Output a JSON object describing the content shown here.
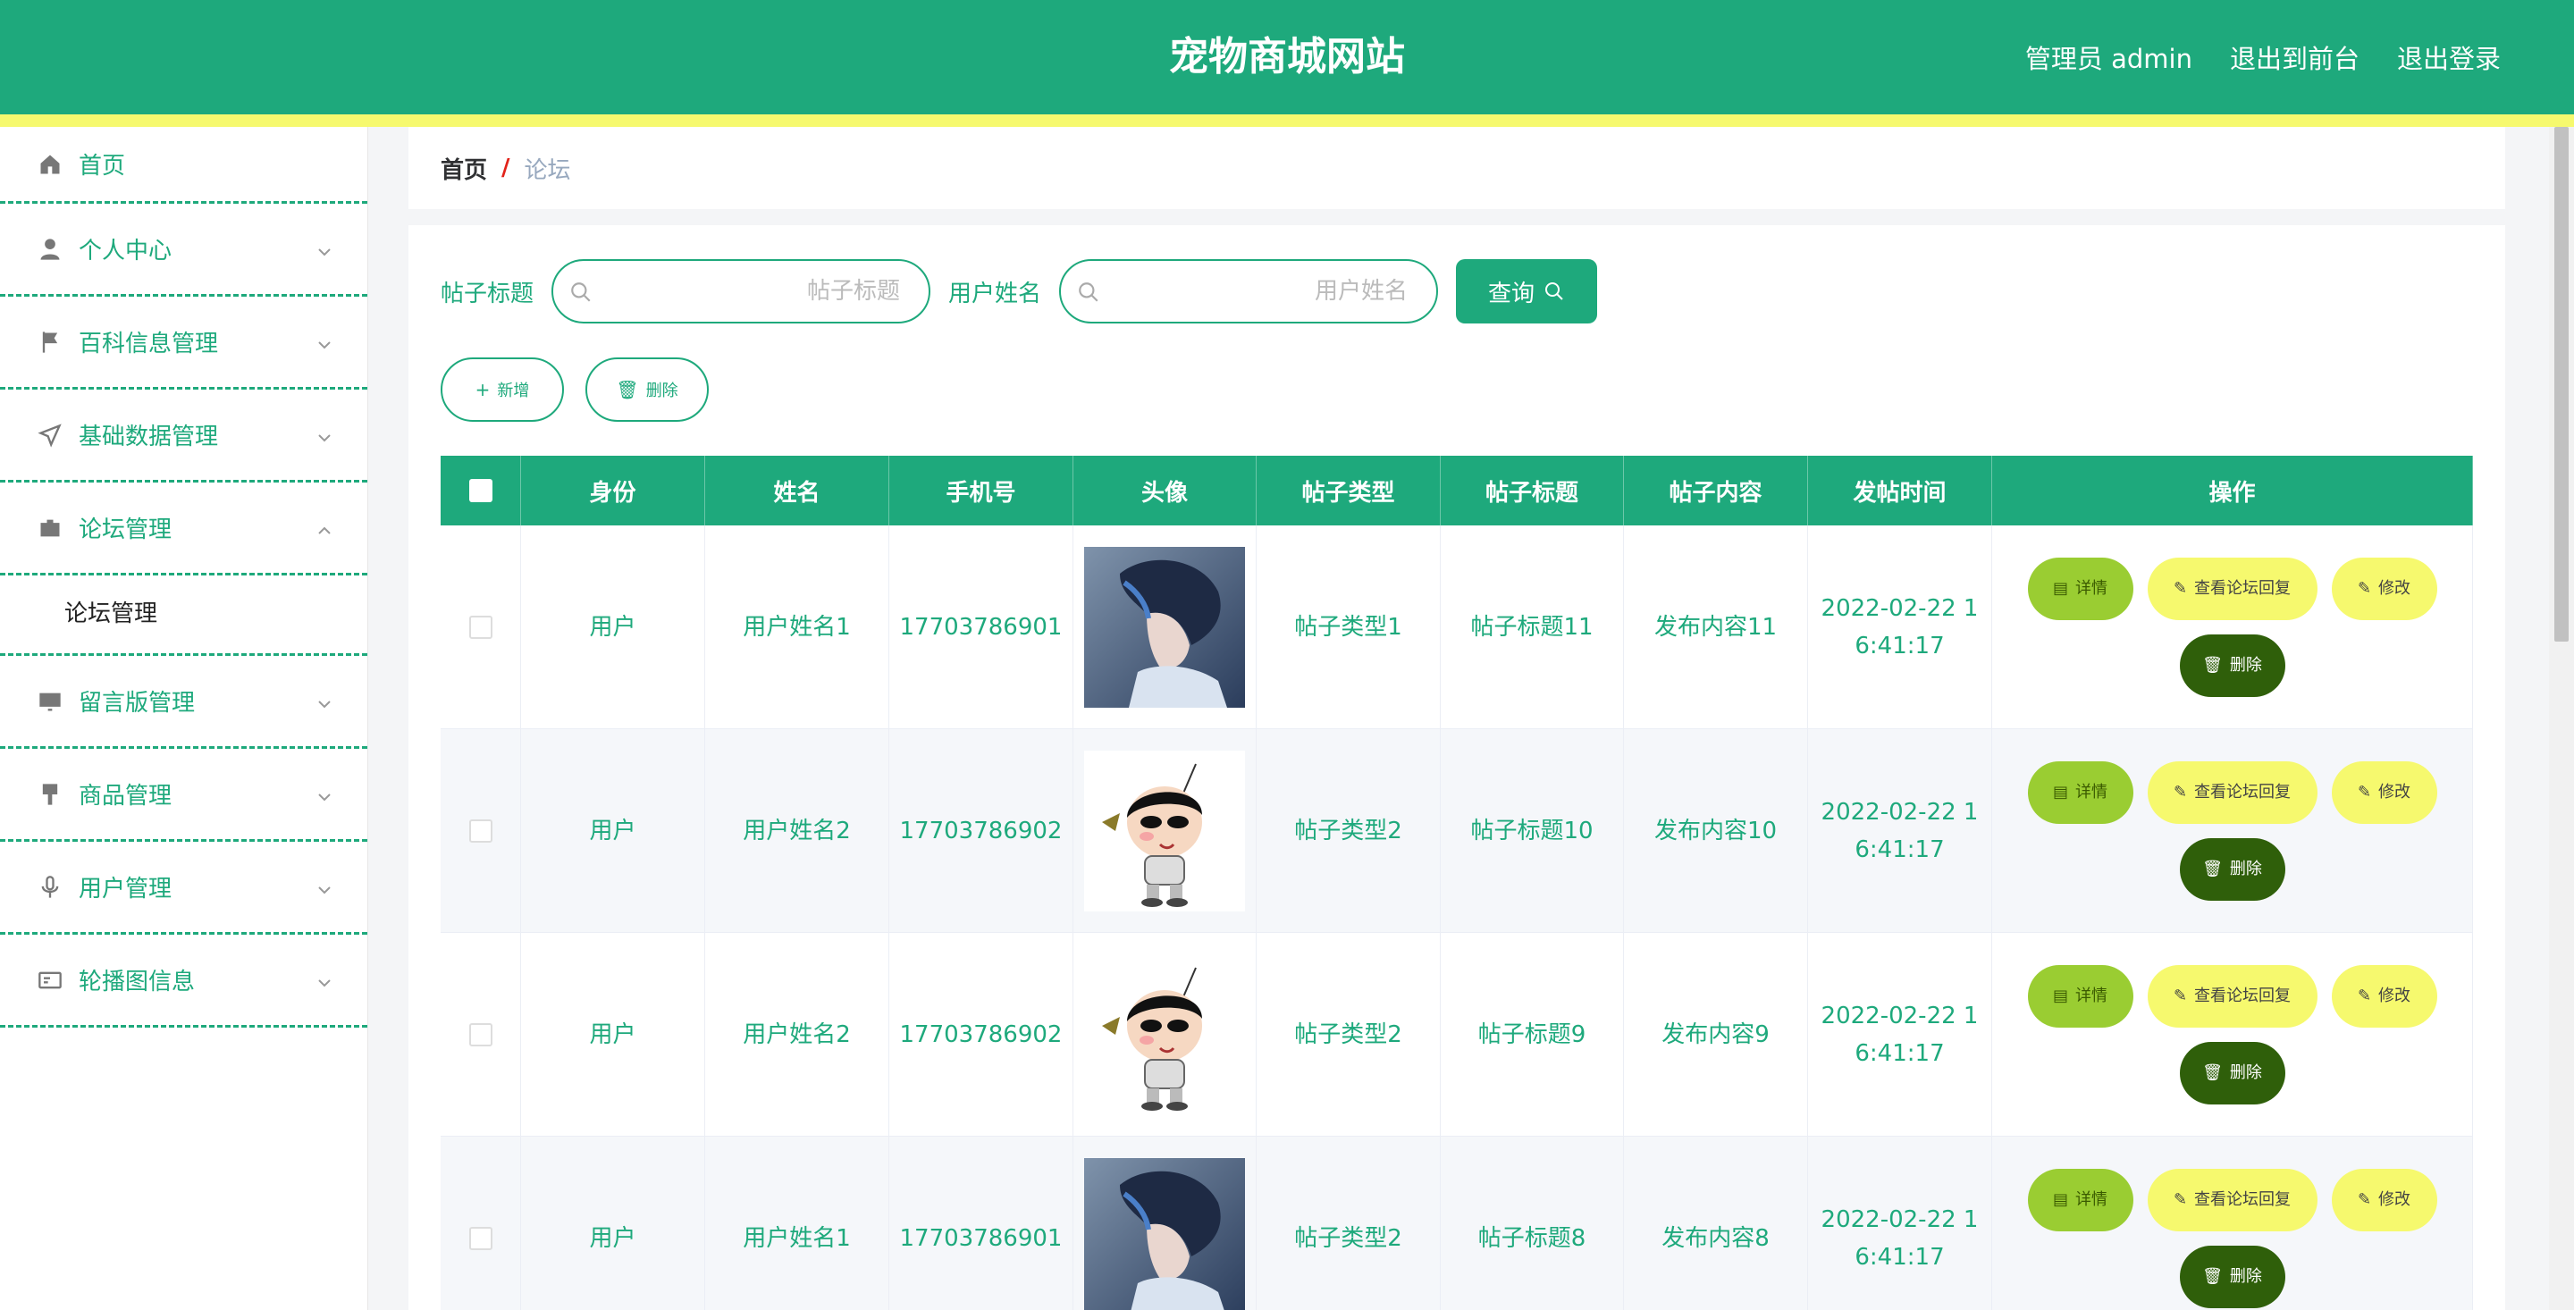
{
  "header": {
    "title": "宠物商城网站",
    "admin_label": "管理员 admin",
    "to_front": "退出到前台",
    "logout": "退出登录",
    "bg_color": "#1ea97c",
    "stripe_color": "#f6f96e"
  },
  "sidebar": {
    "items": [
      {
        "label": "首页",
        "icon": "home-icon"
      },
      {
        "label": "个人中心",
        "icon": "user-icon"
      },
      {
        "label": "百科信息管理",
        "icon": "flag-icon"
      },
      {
        "label": "基础数据管理",
        "icon": "send-icon"
      },
      {
        "label": "论坛管理",
        "icon": "briefcase-icon"
      },
      {
        "label": "留言版管理",
        "icon": "monitor-icon"
      },
      {
        "label": "商品管理",
        "icon": "brush-icon"
      },
      {
        "label": "用户管理",
        "icon": "microphone-icon"
      },
      {
        "label": "轮播图信息",
        "icon": "postcard-icon"
      }
    ],
    "sub_item": "论坛管理"
  },
  "breadcrumb": {
    "home": "首页",
    "sep": "/",
    "current": "论坛"
  },
  "search": {
    "title_label": "帖子标题",
    "title_placeholder": "帖子标题",
    "name_label": "用户姓名",
    "name_placeholder": "用户姓名",
    "query": "查询"
  },
  "actions": {
    "add": "新增",
    "delete": "删除"
  },
  "table": {
    "headers": [
      "身份",
      "姓名",
      "手机号",
      "头像",
      "帖子类型",
      "帖子标题",
      "帖子内容",
      "发帖时间",
      "操作"
    ],
    "rows": [
      {
        "role": "用户",
        "name": "用户姓名1",
        "phone": "17703786901",
        "avatar": "anime-boy-avatar",
        "type": "帖子类型1",
        "title": "帖子标题11",
        "content": "发布内容11",
        "time": "2022-02-22 1\n6:41:17"
      },
      {
        "role": "用户",
        "name": "用户姓名2",
        "phone": "17703786902",
        "avatar": "cartoon-kid-avatar",
        "type": "帖子类型2",
        "title": "帖子标题10",
        "content": "发布内容10",
        "time": "2022-02-22 1\n6:41:17"
      },
      {
        "role": "用户",
        "name": "用户姓名2",
        "phone": "17703786902",
        "avatar": "cartoon-kid-avatar",
        "type": "帖子类型2",
        "title": "帖子标题9",
        "content": "发布内容9",
        "time": "2022-02-22 1\n6:41:17"
      },
      {
        "role": "用户",
        "name": "用户姓名1",
        "phone": "17703786901",
        "avatar": "anime-boy-avatar",
        "type": "帖子类型2",
        "title": "帖子标题8",
        "content": "发布内容8",
        "time": "2022-02-22 1\n6:41:17"
      }
    ],
    "ops": {
      "detail": "详情",
      "reply": "查看论坛回复",
      "edit": "修改",
      "delete": "删除"
    }
  }
}
